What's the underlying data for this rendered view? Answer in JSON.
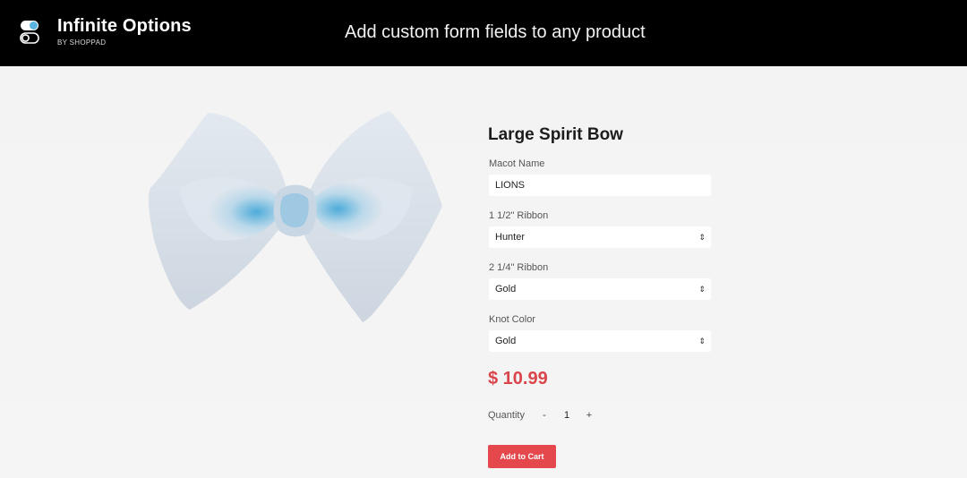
{
  "header": {
    "brand_name": "Infinite Options",
    "brand_by": "BY SHOPPAD",
    "tagline": "Add custom form fields to any product",
    "logo_icon": "toggle-switch-icon"
  },
  "product": {
    "title": "Large Spirit Bow",
    "image_icon": "hair-bow-image",
    "fields": [
      {
        "label": "Macot Name",
        "value": "LIONS",
        "type": "text"
      },
      {
        "label": "1 1/2\" Ribbon",
        "value": "Hunter",
        "type": "select"
      },
      {
        "label": "2 1/4\" Ribbon",
        "value": "Gold",
        "type": "select"
      },
      {
        "label": "Knot Color",
        "value": "Gold",
        "type": "select"
      }
    ],
    "select_chevron": "⇕",
    "price": "$ 10.99",
    "quantity_label": "Quantity",
    "quantity_decrement": "-",
    "quantity_value": "1",
    "quantity_increment": "+",
    "add_to_cart_label": "Add to Cart"
  },
  "colors": {
    "header_bg": "#000000",
    "price": "#d9454a",
    "cart_button": "#e4484d",
    "logo_blue": "#5ab4e0"
  }
}
